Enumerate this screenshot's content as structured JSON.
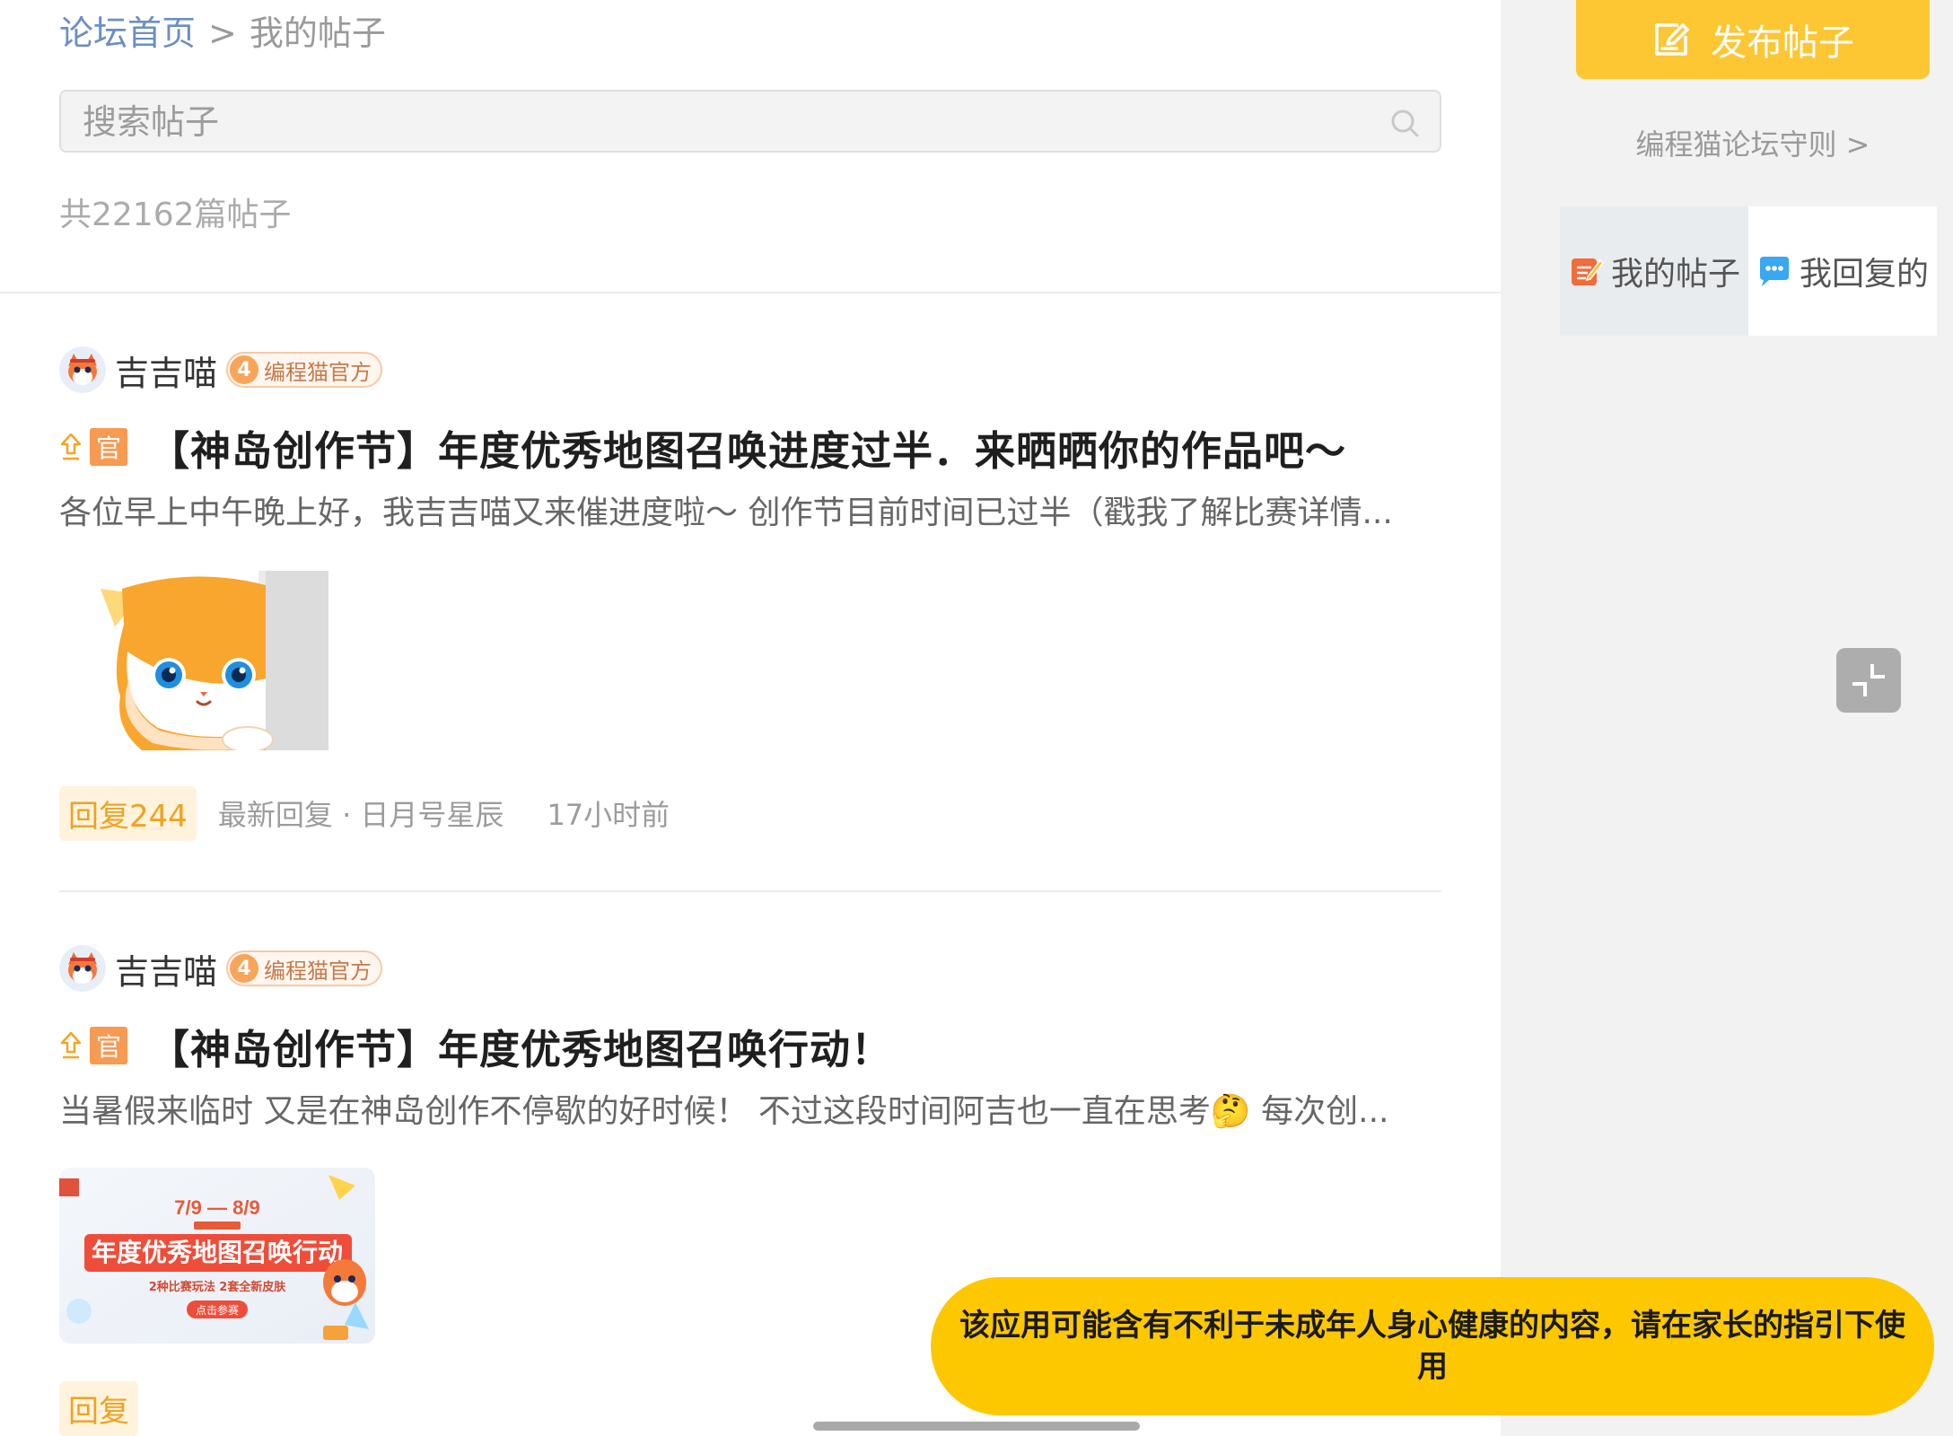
{
  "breadcrumb": {
    "home": "论坛首页",
    "separator": ">",
    "current": "我的帖子"
  },
  "search": {
    "placeholder": "搜索帖子"
  },
  "post_count": "共22162篇帖子",
  "posts": [
    {
      "author": "吉吉喵",
      "badge_level": "4",
      "badge_text": "编程猫官方",
      "tag": "官",
      "title": "【神岛创作节】年度优秀地图召唤进度过半．来晒晒你的作品吧～",
      "excerpt": "各位早上中午晚上好，我吉吉喵又来催进度啦～ 创作节目前时间已过半（戳我了解比赛详情...",
      "reply": "回复244",
      "latest_reply": "最新回复 · 日月号星辰",
      "time": "17小时前"
    },
    {
      "author": "吉吉喵",
      "badge_level": "4",
      "badge_text": "编程猫官方",
      "tag": "官",
      "title": "【神岛创作节】年度优秀地图召唤行动！",
      "excerpt": "当暑假来临时 又是在神岛创作不停歇的好时候！ 不过这段时间阿吉也一直在思考🤔 每次创...",
      "reply": "回复",
      "banner": {
        "date": "7/9 — 8/9",
        "title": "年度优秀地图召唤行动",
        "sub": "2种比赛玩法  2套全新皮肤",
        "cta": "点击参赛"
      }
    }
  ],
  "sidebar": {
    "publish_label": "发布帖子",
    "rules_label": "编程猫论坛守则 >",
    "tabs": [
      {
        "label": "我的帖子",
        "active": true
      },
      {
        "label": "我回复的",
        "active": false
      }
    ]
  },
  "warning": "该应用可能含有不利于未成年人身心健康的内容，请在家长的指引下使用",
  "colors": {
    "accent": "#fdc633",
    "warning_bg": "#fdc800",
    "official_tag": "#f79a52",
    "link": "#6b8fc2"
  }
}
